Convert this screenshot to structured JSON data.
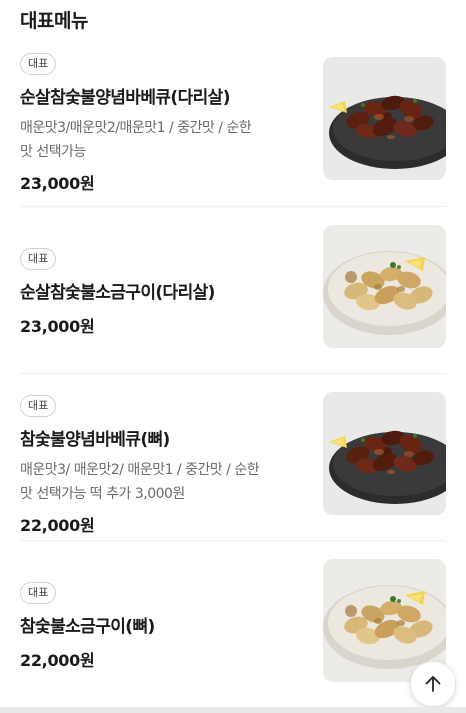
{
  "section": {
    "title": "대표메뉴"
  },
  "menu_items": [
    {
      "badge": "대표",
      "name": "순살참숯불양념바베큐(다리살)",
      "desc_line1": "매운맛3/매운맛2/매운맛1 / 중간맛 / 순한",
      "desc_line2": "맛 선택가능",
      "price": "23,000원",
      "image_icon": "grilled-chicken-spicy-photo"
    },
    {
      "badge": "대표",
      "name": "순살참숯불소금구이(다리살)",
      "price": "23,000원",
      "image_icon": "grilled-chicken-salt-photo"
    },
    {
      "badge": "대표",
      "name": "참숯불양념바베큐(뼈)",
      "desc_line1": "매운맛3/ 매운맛2/ 매운맛1 / 중간맛 / 순한",
      "desc_line2": "맛 선택가능 떡 추가 3,000원",
      "price": "22,000원",
      "image_icon": "grilled-chicken-spicy-photo"
    },
    {
      "badge": "대표",
      "name": "참숯불소금구이(뼈)",
      "price": "22,000원",
      "image_icon": "grilled-chicken-salt-photo"
    }
  ],
  "scroll_top": {
    "icon": "arrow-up-icon"
  }
}
